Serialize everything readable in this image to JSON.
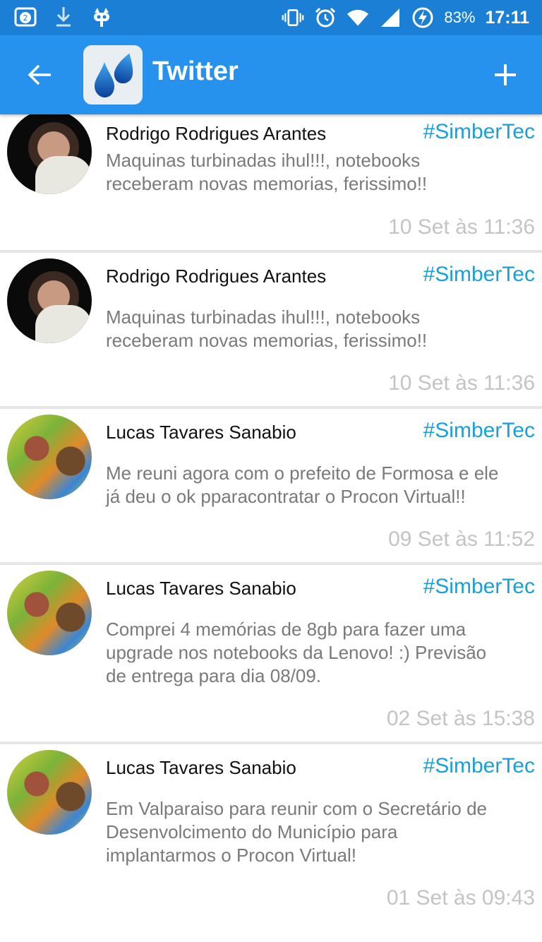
{
  "status_bar": {
    "notif_count": "2",
    "battery": "83%",
    "time": "17:11"
  },
  "app_bar": {
    "title": "Twitter",
    "back_icon": "arrow-left-icon",
    "add_icon": "plus-icon"
  },
  "posts": [
    {
      "author": "Rodrigo Rodrigues Arantes",
      "hashtag": "#SimberTec",
      "text_lines": [
        "Maquinas turbinadas ihul!!!, notebooks",
        "receberam novas memorias, ferissimo!!"
      ],
      "time": "10 Set às 11:36"
    },
    {
      "author": "Rodrigo Rodrigues Arantes",
      "hashtag": "#SimberTec",
      "text_lines": [
        "Maquinas turbinadas ihul!!!, notebooks",
        "receberam novas memorias, ferissimo!!"
      ],
      "time": "10 Set às 11:36"
    },
    {
      "author": "Lucas Tavares Sanabio",
      "hashtag": "#SimberTec",
      "text_lines": [
        "Me reuni agora com o prefeito de Formosa e ele",
        "já deu o ok pparacontratar o Procon Virtual!!"
      ],
      "time": "09 Set às 11:52"
    },
    {
      "author": "Lucas Tavares Sanabio",
      "hashtag": "#SimberTec",
      "text_lines": [
        "Comprei 4 memórias de 8gb para fazer uma",
        "upgrade nos notebooks da Lenovo! :) Previsão",
        "de entrega para dia 08/09."
      ],
      "time": "02 Set às 15:38"
    },
    {
      "author": "Lucas Tavares Sanabio",
      "hashtag": "#SimberTec",
      "text_lines": [
        "Em Valparaiso para reunir com o Secretário de",
        "Desenvolcimento do Município para",
        "implantarmos o Procon Virtual!"
      ],
      "time": "01 Set às 09:43"
    }
  ]
}
